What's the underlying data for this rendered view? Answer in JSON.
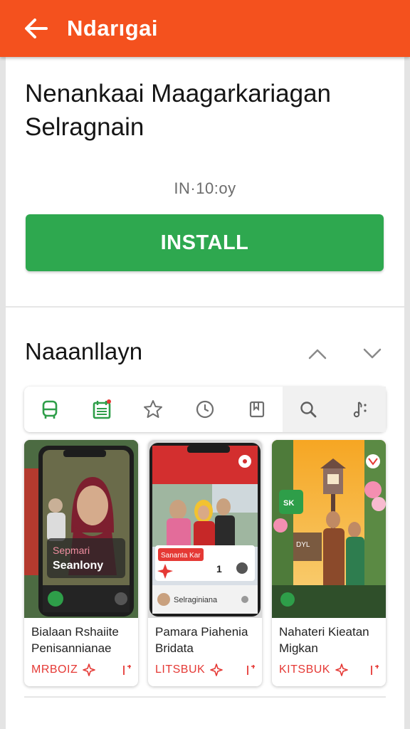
{
  "colors": {
    "header": "#f4511e",
    "install": "#2ea84f",
    "accent_green": "#2e9e49",
    "tag_red": "#e53935"
  },
  "header": {
    "back_icon": "arrow-left-icon",
    "title": "Ndarıgai"
  },
  "app": {
    "title": "Nenankaai Maagarkariagan Selragnain",
    "meta": "IN·10:oy",
    "install_label": "INSTALL"
  },
  "section": {
    "title": "Naaanllayn",
    "up_icon": "chevron-up-icon",
    "down_icon": "chevron-down-icon"
  },
  "tabs": [
    {
      "icon": "bus-icon"
    },
    {
      "icon": "calendar-list-icon"
    },
    {
      "icon": "star-icon"
    },
    {
      "icon": "clock-icon"
    },
    {
      "icon": "bookmark-icon"
    },
    {
      "icon": "search-icon"
    },
    {
      "icon": "music-note-icon"
    }
  ],
  "cards": [
    {
      "overlay_line1": "Sepmari",
      "overlay_line2": "Seanlony",
      "name": "Bialaan Rshaiite Penisannianae",
      "tag": "MRBOIZ"
    },
    {
      "badge_text": "Sananta Kar",
      "count": "1",
      "profile_text": "Selraginiana",
      "name": "Pamara Piahenia Bridata",
      "tag": "LITSBUK"
    },
    {
      "logo_text": "SK",
      "sign_text": "DYL",
      "name": "Nahateri Kieatan Migkan",
      "tag": "KITSBUK"
    }
  ]
}
